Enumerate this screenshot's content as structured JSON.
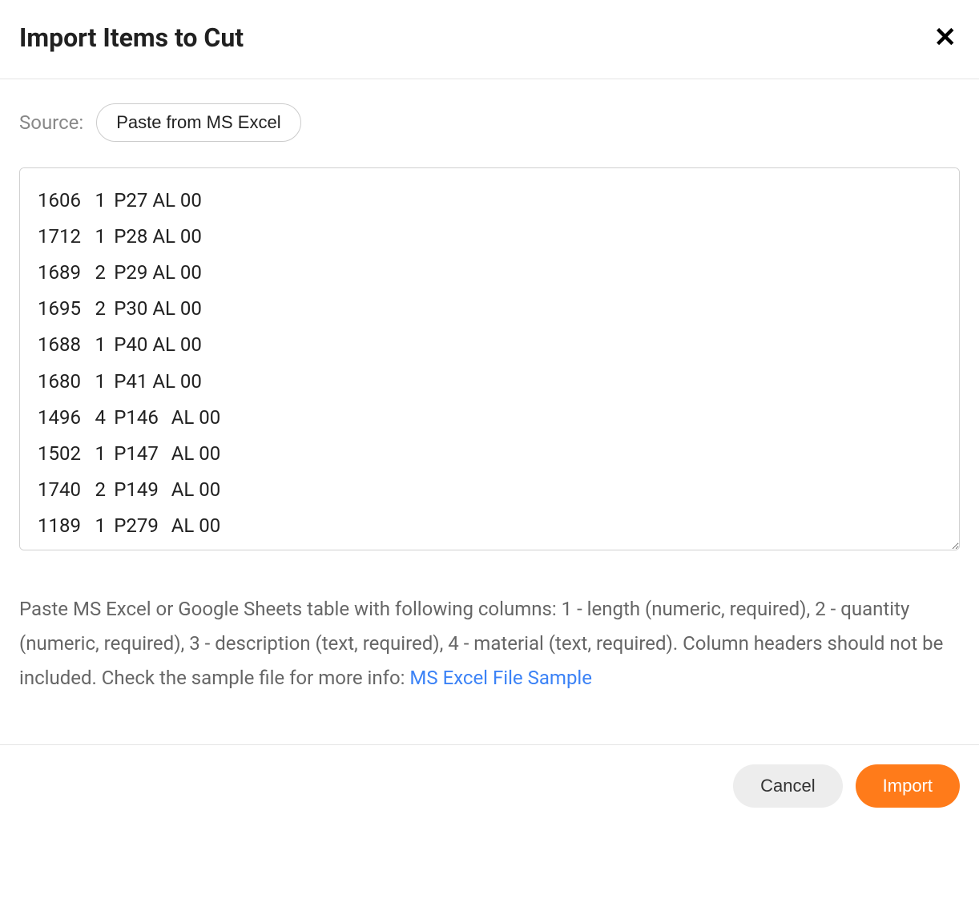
{
  "modal": {
    "title": "Import Items to Cut",
    "source_label": "Source:",
    "source_option": "Paste from MS Excel",
    "paste_content": "1606\t1\tP27 AL 00\n1712\t1\tP28 AL 00\n1689\t2\tP29 AL 00\n1695\t2\tP30 AL 00\n1688\t1\tP40 AL 00\n1680\t1\tP41 AL 00\n1496\t4\tP146\tAL 00\n1502\t1\tP147\tAL 00\n1740\t2\tP149\tAL 00\n1189\t1\tP279\tAL 00",
    "help_text_prefix": "Paste MS Excel or Google Sheets table with following columns: 1 - length (numeric, required), 2 - quantity (numeric, required), 3 - description (text, required), 4 - material (text, required). Column headers should not be included. Check the sample file for more info: ",
    "help_link_text": "MS Excel File Sample",
    "cancel_label": "Cancel",
    "import_label": "Import"
  },
  "paste_rows": [
    {
      "length": 1606,
      "qty": 1,
      "desc": "P27 AL 00"
    },
    {
      "length": 1712,
      "qty": 1,
      "desc": "P28 AL 00"
    },
    {
      "length": 1689,
      "qty": 2,
      "desc": "P29 AL 00"
    },
    {
      "length": 1695,
      "qty": 2,
      "desc": "P30 AL 00"
    },
    {
      "length": 1688,
      "qty": 1,
      "desc": "P40 AL 00"
    },
    {
      "length": 1680,
      "qty": 1,
      "desc": "P41 AL 00"
    },
    {
      "length": 1496,
      "qty": 4,
      "desc": "P146",
      "material": "AL 00"
    },
    {
      "length": 1502,
      "qty": 1,
      "desc": "P147",
      "material": "AL 00"
    },
    {
      "length": 1740,
      "qty": 2,
      "desc": "P149",
      "material": "AL 00"
    },
    {
      "length": 1189,
      "qty": 1,
      "desc": "P279",
      "material": "AL 00"
    }
  ]
}
